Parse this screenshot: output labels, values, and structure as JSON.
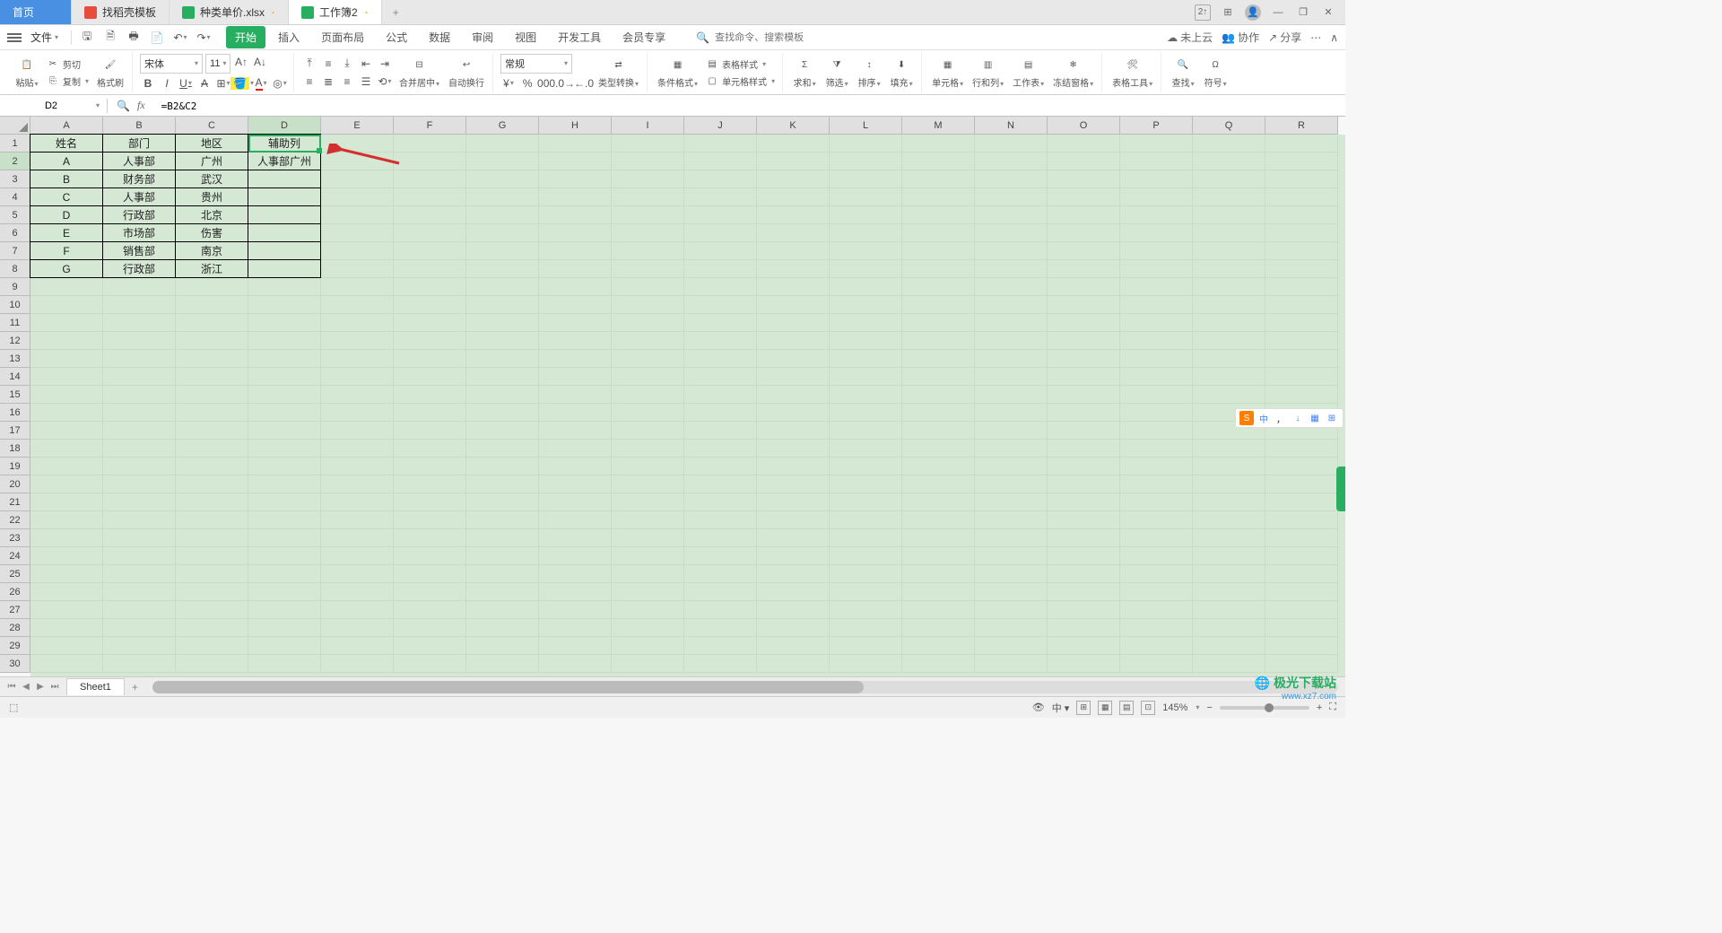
{
  "titlebar": {
    "home": "首页",
    "tabs": [
      {
        "icon": "red",
        "label": "找稻壳模板"
      },
      {
        "icon": "green",
        "label": "种类单价.xlsx",
        "modified": true
      },
      {
        "icon": "green",
        "label": "工作簿2",
        "modified": true,
        "active": true
      }
    ],
    "add": "+",
    "sync_badge": "2↑"
  },
  "menu": {
    "file": "文件",
    "tabs": [
      "开始",
      "插入",
      "页面布局",
      "公式",
      "数据",
      "审阅",
      "视图",
      "开发工具",
      "会员专享"
    ],
    "search_placeholder": "查找命令、搜索模板",
    "right": {
      "cloud": "未上云",
      "coop": "协作",
      "share": "分享"
    }
  },
  "ribbon": {
    "paste": "粘贴",
    "cut": "剪切",
    "copy": "复制",
    "format_painter": "格式刷",
    "font_name": "宋体",
    "font_size": "11",
    "merge": "合并居中",
    "wrap": "自动换行",
    "number_format": "常规",
    "type_convert": "类型转换",
    "cond_fmt": "条件格式",
    "table_style": "表格样式",
    "cell_style": "单元格样式",
    "sum": "求和",
    "filter": "筛选",
    "sort": "排序",
    "fill": "填充",
    "cell": "单元格",
    "row_col": "行和列",
    "sheet": "工作表",
    "freeze": "冻结窗格",
    "table_tools": "表格工具",
    "find": "查找",
    "symbol": "符号"
  },
  "formula": {
    "cell_ref": "D2",
    "value": "=B2&C2"
  },
  "columns": [
    "A",
    "B",
    "C",
    "D",
    "E",
    "F",
    "G",
    "H",
    "I",
    "J",
    "K",
    "L",
    "M",
    "N",
    "O",
    "P",
    "Q",
    "R"
  ],
  "data_table": {
    "headers": [
      "姓名",
      "部门",
      "地区",
      "辅助列"
    ],
    "rows": [
      [
        "A",
        "人事部",
        "广州",
        "人事部广州"
      ],
      [
        "B",
        "财务部",
        "武汉",
        ""
      ],
      [
        "C",
        "人事部",
        "贵州",
        ""
      ],
      [
        "D",
        "行政部",
        "北京",
        ""
      ],
      [
        "E",
        "市场部",
        "伤害",
        ""
      ],
      [
        "F",
        "销售部",
        "南京",
        ""
      ],
      [
        "G",
        "行政部",
        "浙江",
        ""
      ]
    ]
  },
  "selected_cell": {
    "col": 3,
    "row": 1
  },
  "total_rows": 30,
  "sheet": {
    "name": "Sheet1"
  },
  "status": {
    "zoom": "145%",
    "views": [
      "⊞",
      "▦",
      "▤",
      "⊡"
    ]
  },
  "ime": {
    "logo": "S",
    "lang": "中",
    "items": [
      "，",
      "↓",
      "▦",
      "⊞"
    ]
  },
  "watermark": {
    "brand": "极光下载站",
    "url": "www.xz7.com"
  }
}
